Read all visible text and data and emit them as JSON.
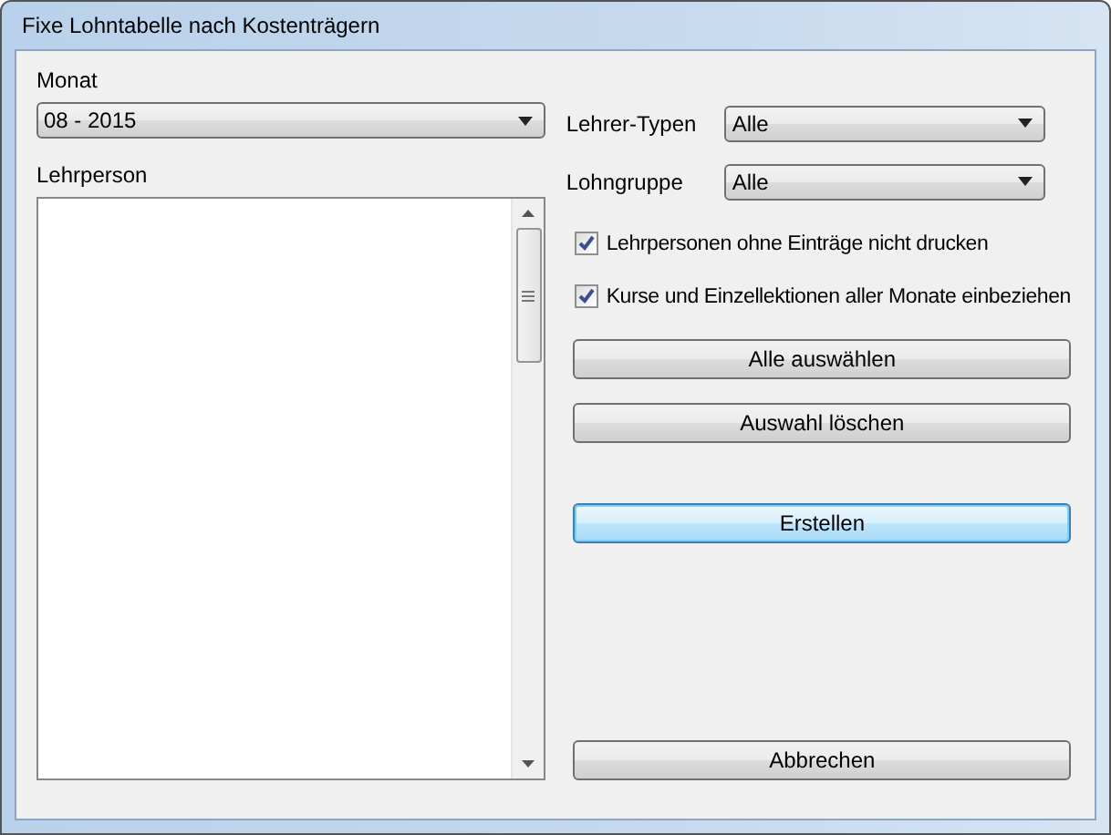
{
  "window": {
    "title": "Fixe Lohntabelle nach Kostenträgern"
  },
  "month": {
    "label": "Monat",
    "value": "08 - 2015"
  },
  "teachers": {
    "label": "Lehrperson"
  },
  "teacher_types": {
    "label": "Lehrer-Typen",
    "value": "Alle"
  },
  "wage_group": {
    "label": "Lohngruppe",
    "value": "Alle"
  },
  "options": [
    {
      "label": "Lehrpersonen ohne Einträge nicht drucken",
      "checked": true
    },
    {
      "label": "Kurse und Einzellektionen aller Monate einbeziehen",
      "checked": true
    }
  ],
  "buttons": [
    {
      "label": "Alle auswählen",
      "focused": false
    },
    {
      "label": "Auswahl löschen",
      "focused": false
    },
    {
      "label": "Erstellen",
      "focused": true
    },
    {
      "label": "Abbrechen",
      "focused": false
    }
  ]
}
